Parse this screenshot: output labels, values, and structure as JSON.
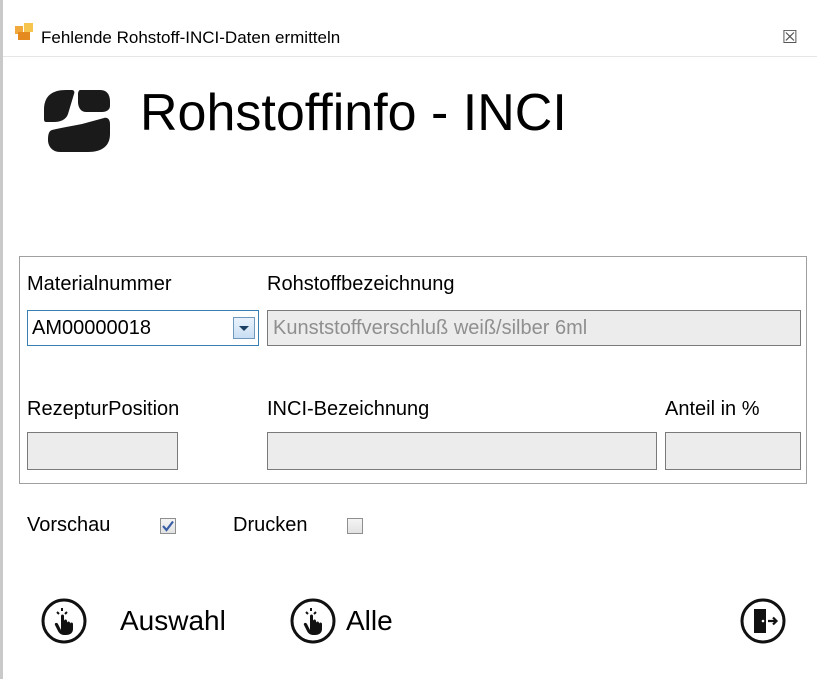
{
  "window": {
    "title": "Fehlende Rohstoff-INCI-Daten ermitteln",
    "close_glyph": "☒"
  },
  "header": {
    "title": "Rohstoffinfo - INCI",
    "logo_icon": "app-logo-icon"
  },
  "form": {
    "materialnummer": {
      "label": "Materialnummer",
      "value": "AM00000018"
    },
    "rohstoffbezeichnung": {
      "label": "Rohstoffbezeichnung",
      "value": "Kunststoffverschluß weiß/silber 6ml"
    },
    "rezepturposition": {
      "label": "RezepturPosition",
      "value": ""
    },
    "inci_bezeichnung": {
      "label": "INCI-Bezeichnung",
      "value": ""
    },
    "anteil": {
      "label": "Anteil in %",
      "value": ""
    }
  },
  "options": {
    "vorschau": {
      "label": "Vorschau",
      "checked": true
    },
    "drucken": {
      "label": "Drucken",
      "checked": false
    }
  },
  "buttons": {
    "auswahl": "Auswahl",
    "alle": "Alle",
    "exit_icon": "exit-door-icon"
  },
  "colors": {
    "accent": "#3c7fb1",
    "field_bg": "#ececec",
    "disabled_text": "#8f8f8f"
  }
}
